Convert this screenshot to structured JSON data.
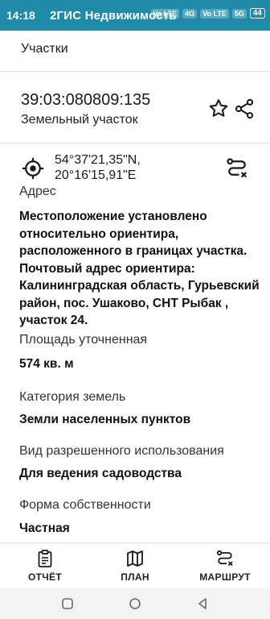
{
  "status_bar": {
    "time": "14:18",
    "app_name": "2ГИС Недвижимость",
    "signal_labels": [
      "Vo LTE",
      "4G",
      "Vo LTE",
      "5G"
    ],
    "battery": "44"
  },
  "tabs": {
    "active": "Участки"
  },
  "parcel": {
    "cadastral_number": "39:03:080809:135",
    "type": "Земельный участок"
  },
  "location": {
    "lat": "54°37'21,35\"N,",
    "lon": "20°16'15,91\"E"
  },
  "details": {
    "address_label": "Адрес",
    "address_lines": [
      "Местоположение установлено",
      "относительно ориентира,",
      "расположенного в границах участка.",
      "Почтовый адрес ориентира:",
      "Калининградская область, Гурьевский",
      "район, пос. Ушаково, СНТ Рыбак ,",
      "участок 24."
    ],
    "area_label": "Площадь уточненная",
    "area_value": "574 кв. м",
    "category_label": "Категория земель",
    "category_value": "Земли населенных пунктов",
    "use_label": "Вид разрешенного использования",
    "use_value": "Для ведения садоводства",
    "ownership_label": "Форма собственности",
    "ownership_value": "Частная"
  },
  "bottom_nav": {
    "report": "ОТЧЁТ",
    "plan": "ПЛАН",
    "route": "МАРШРУТ"
  },
  "colors": {
    "status_bar": "#1f8ba8"
  }
}
